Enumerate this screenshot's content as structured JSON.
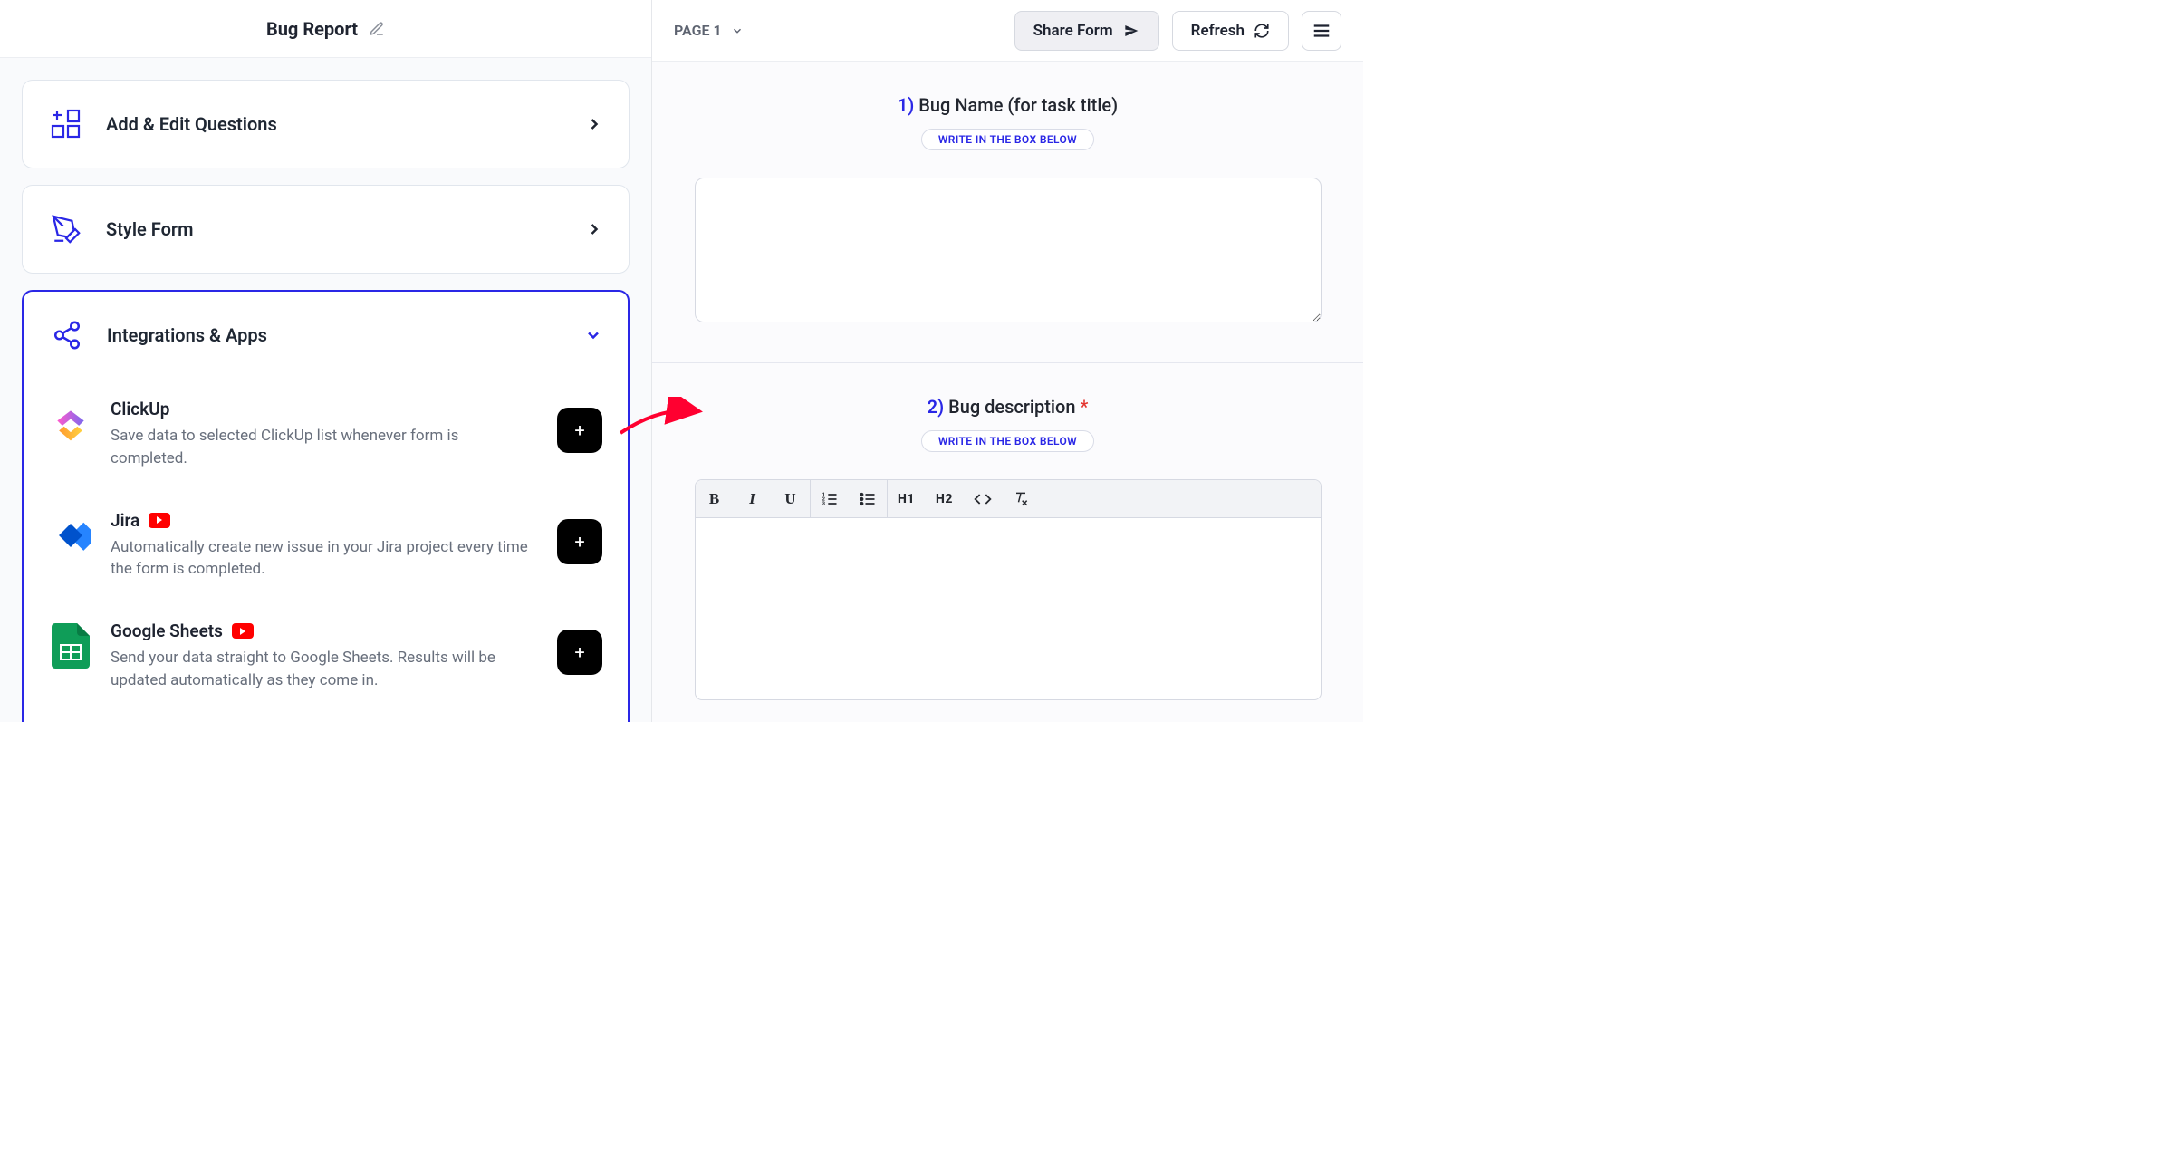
{
  "header": {
    "title": "Bug Report"
  },
  "left_nav": {
    "add_edit": "Add & Edit Questions",
    "style_form": "Style Form",
    "integrations_title": "Integrations & Apps"
  },
  "integrations": [
    {
      "name": "ClickUp",
      "desc": "Save data to selected ClickUp list whenever form is completed.",
      "has_video": false
    },
    {
      "name": "Jira",
      "desc": "Automatically create new issue in your Jira project every time the form is completed.",
      "has_video": true
    },
    {
      "name": "Google Sheets",
      "desc": "Send your data straight to Google Sheets. Results will be updated automatically as they come in.",
      "has_video": true
    }
  ],
  "right_header": {
    "page_label": "PAGE 1",
    "share": "Share Form",
    "refresh": "Refresh"
  },
  "questions": {
    "q1": {
      "num": "1)",
      "title": "Bug Name (for task title)",
      "hint": "WRITE IN THE BOX BELOW"
    },
    "q2": {
      "num": "2)",
      "title": "Bug description",
      "hint": "WRITE IN THE BOX BELOW"
    }
  },
  "rte": {
    "bold": "B",
    "italic": "I",
    "underline": "U",
    "h1": "H1",
    "h2": "H2"
  }
}
